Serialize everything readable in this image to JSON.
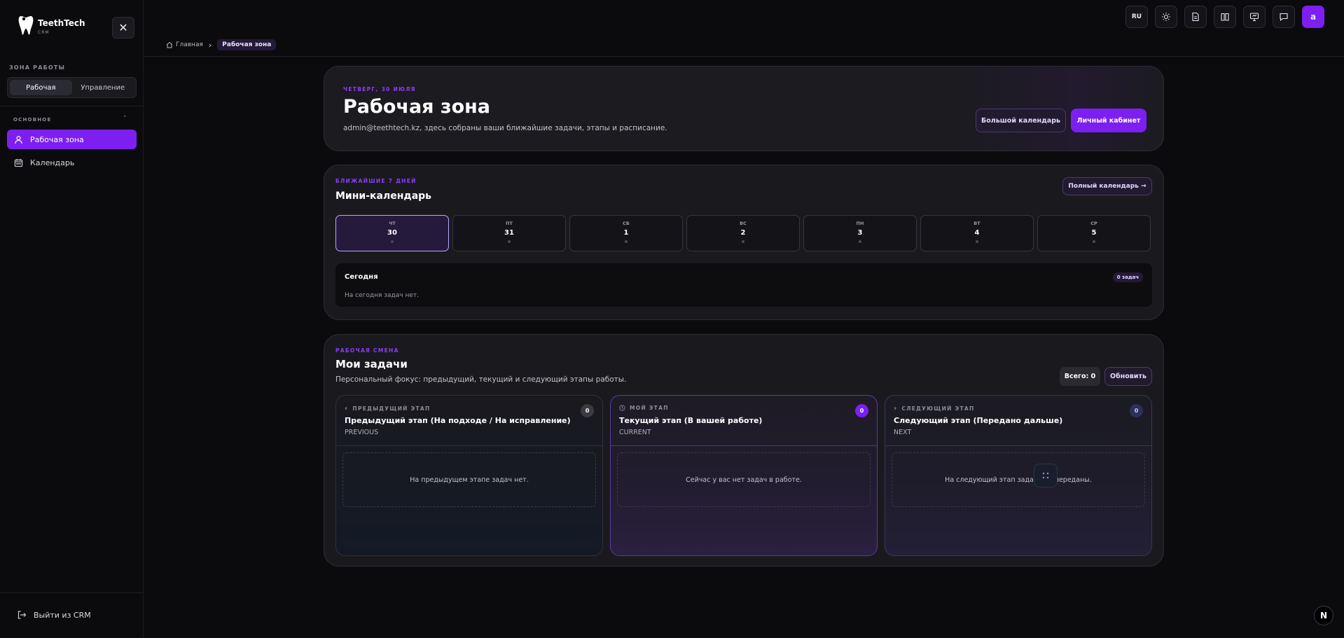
{
  "app": {
    "name": "TeethTech",
    "sub": "CRM"
  },
  "sidebar": {
    "zone_label": "ЗОНА РАБОТЫ",
    "zone_tabs": [
      "Рабочая",
      "Управление"
    ],
    "section_label": "ОСНОВНОЕ",
    "items": [
      {
        "label": "Рабочая зона"
      },
      {
        "label": "Календарь"
      }
    ],
    "logout_label": "Выйти из CRM"
  },
  "breadcrumb": {
    "home": "Главная",
    "current": "Рабочая зона"
  },
  "topbar": {
    "lang": "RU",
    "avatar": "a"
  },
  "hero": {
    "date": "ЧЕТВЕРГ, 30 ИЮЛЯ",
    "title": "Рабочая зона",
    "subtitle": "admin@teethtech.kz, здесь собраны ваши ближайшие задачи, этапы и расписание.",
    "btn_calendar": "Большой календарь",
    "btn_cabinet": "Личный кабинет"
  },
  "mini_calendar": {
    "eyebrow": "БЛИЖАЙШИЕ 7 ДНЕЙ",
    "title": "Мини-календарь",
    "full_btn": "Полный календарь →",
    "days": [
      {
        "dw": "ЧТ",
        "dn": "30"
      },
      {
        "dw": "ПТ",
        "dn": "31"
      },
      {
        "dw": "СБ",
        "dn": "1"
      },
      {
        "dw": "ВС",
        "dn": "2"
      },
      {
        "dw": "ПН",
        "dn": "3"
      },
      {
        "dw": "ВТ",
        "dn": "4"
      },
      {
        "dw": "СР",
        "dn": "5"
      }
    ],
    "today_title": "Сегодня",
    "today_badge": "0 задач",
    "today_empty": "На сегодня задач нет."
  },
  "tasks": {
    "eyebrow": "РАБОЧАЯ СМЕНА",
    "title": "Мои задачи",
    "subtitle": "Персональный фокус: предыдущий, текущий и следующий этапы работы.",
    "total": "Всего: 0",
    "refresh": "Обновить",
    "stages": [
      {
        "label": "ПРЕДЫДУЩИЙ ЭТАП",
        "title": "Предыдущий этап (На подходе / На исправление)",
        "code": "PREVIOUS",
        "count": "0",
        "empty": "На предыдущем этапе задач нет.",
        "color": "#3a3a42"
      },
      {
        "label": "МОЙ ЭТАП",
        "title": "Текущий этап (В вашей работе)",
        "code": "CURRENT",
        "count": "0",
        "empty": "Сейчас у вас нет задач в работе.",
        "color": "#7c1ff0"
      },
      {
        "label": "СЛЕДУЮЩИЙ ЭТАП",
        "title": "Следующий этап (Передано дальше)",
        "code": "NEXT",
        "count": "0",
        "empty": "На следующий этап задачи не переданы.",
        "color": "#2c2f5a"
      }
    ]
  },
  "fab": "N"
}
